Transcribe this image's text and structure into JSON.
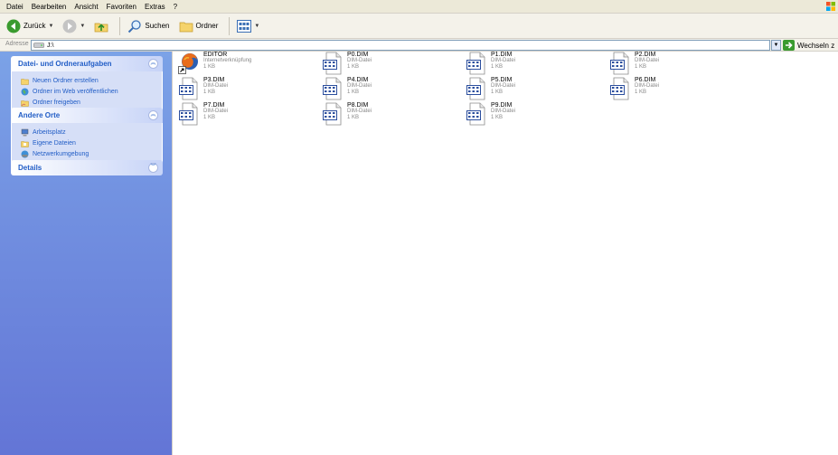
{
  "menu": [
    "Datei",
    "Bearbeiten",
    "Ansicht",
    "Favoriten",
    "Extras",
    "?"
  ],
  "toolbar": {
    "back_label": "Zurück",
    "search_label": "Suchen",
    "folders_label": "Ordner"
  },
  "address": {
    "label": "Adresse",
    "path": "J:\\",
    "go_label": "Wechseln z"
  },
  "panels": {
    "tasks": {
      "title": "Datei- und Ordneraufgaben",
      "items": [
        "Neuen Ordner erstellen",
        "Ordner im Web veröffentlichen",
        "Ordner freigeben"
      ]
    },
    "places": {
      "title": "Andere Orte",
      "items": [
        "Arbeitsplatz",
        "Eigene Dateien",
        "Netzwerkumgebung"
      ]
    },
    "details": {
      "title": "Details"
    }
  },
  "files": [
    {
      "name": "EDITOR",
      "type": "Internetverknüpfung",
      "size": "1 KB",
      "icon": "firefox-shortcut-icon"
    },
    {
      "name": "P0.DIM",
      "type": "DIM-Datei",
      "size": "1 KB",
      "icon": "dim-file-icon"
    },
    {
      "name": "P1.DIM",
      "type": "DIM-Datei",
      "size": "1 KB",
      "icon": "dim-file-icon"
    },
    {
      "name": "P2.DIM",
      "type": "DIM-Datei",
      "size": "1 KB",
      "icon": "dim-file-icon"
    },
    {
      "name": "P3.DIM",
      "type": "DIM-Datei",
      "size": "1 KB",
      "icon": "dim-file-icon"
    },
    {
      "name": "P4.DIM",
      "type": "DIM-Datei",
      "size": "1 KB",
      "icon": "dim-file-icon"
    },
    {
      "name": "P5.DIM",
      "type": "DIM-Datei",
      "size": "1 KB",
      "icon": "dim-file-icon"
    },
    {
      "name": "P6.DIM",
      "type": "DIM-Datei",
      "size": "1 KB",
      "icon": "dim-file-icon"
    },
    {
      "name": "P7.DIM",
      "type": "DIM-Datei",
      "size": "1 KB",
      "icon": "dim-file-icon"
    },
    {
      "name": "P8.DIM",
      "type": "DIM-Datei",
      "size": "1 KB",
      "icon": "dim-file-icon"
    },
    {
      "name": "P9.DIM",
      "type": "DIM-Datei",
      "size": "1 KB",
      "icon": "dim-file-icon"
    }
  ],
  "colors": {
    "pane_gradient_top": "#7ba2e7",
    "pane_gradient_bottom": "#6375d6",
    "task_link": "#215dc6"
  }
}
